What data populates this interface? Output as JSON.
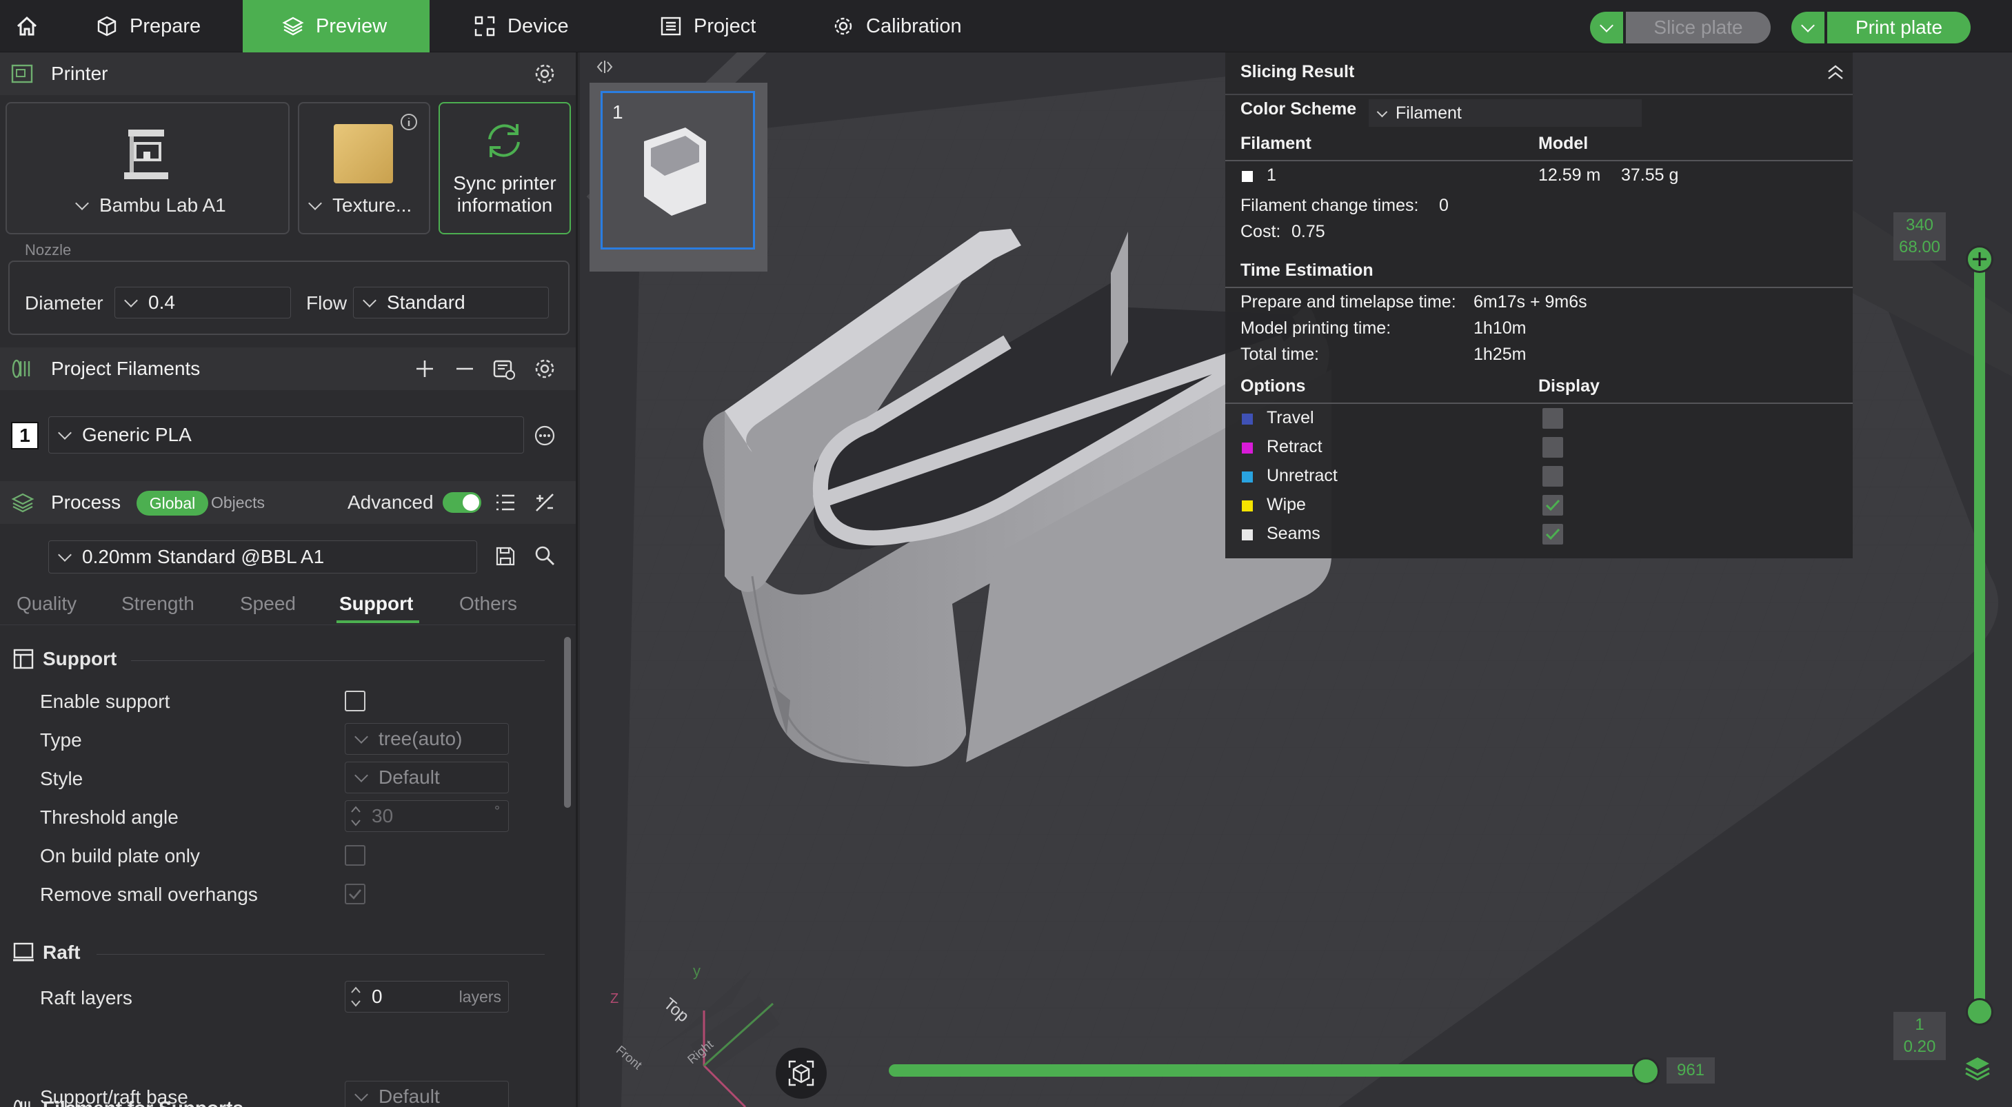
{
  "topbar": {
    "tabs": [
      {
        "label": "Prepare"
      },
      {
        "label": "Preview"
      },
      {
        "label": "Device"
      },
      {
        "label": "Project"
      },
      {
        "label": "Calibration"
      }
    ],
    "slice_plate": "Slice plate",
    "print_plate": "Print plate",
    "accent": "#4caf50"
  },
  "printer": {
    "title": "Printer",
    "model": "Bambu Lab A1",
    "plate": "Texture...",
    "sync_line1": "Sync printer",
    "sync_line2": "information",
    "nozzle_label": "Nozzle",
    "diameter_label": "Diameter",
    "diameter_value": "0.4",
    "flow_label": "Flow",
    "flow_value": "Standard"
  },
  "filaments": {
    "title": "Project Filaments",
    "items": [
      {
        "index": "1",
        "name": "Generic PLA"
      }
    ]
  },
  "process": {
    "title": "Process",
    "global": "Global",
    "objects": "Objects",
    "advanced": "Advanced",
    "advanced_on": true,
    "profile": "0.20mm Standard @BBL A1",
    "tabs": [
      "Quality",
      "Strength",
      "Speed",
      "Support",
      "Others"
    ],
    "active_tab": "Support"
  },
  "support": {
    "title": "Support",
    "enable_support": "Enable support",
    "type_label": "Type",
    "type_value": "tree(auto)",
    "style_label": "Style",
    "style_value": "Default",
    "threshold_label": "Threshold angle",
    "threshold_value": "30",
    "threshold_unit": "°",
    "build_plate_label": "On build plate only",
    "remove_overhangs_label": "Remove small overhangs",
    "raft_title": "Raft",
    "raft_layers_label": "Raft layers",
    "raft_layers_value": "0",
    "raft_layers_unit": "layers",
    "filament_supports_title": "Filament for Supports",
    "support_raft_base_label": "Support/raft base",
    "support_raft_base_value": "Default"
  },
  "viewport": {
    "plate_number": "1",
    "axis_z": "Z",
    "axis_y": "y",
    "cube_top": "Top",
    "cube_front": "Front",
    "cube_right": "Right",
    "layer_top_count": "340",
    "layer_top_height": "68.00",
    "layer_bottom_count": "1",
    "layer_bottom_height": "0.20",
    "move_value": "961"
  },
  "slicing_result": {
    "title": "Slicing Result",
    "color_scheme_label": "Color Scheme",
    "color_scheme_value": "Filament",
    "filament_header": "Filament",
    "model_header": "Model",
    "filament_id": "1",
    "filament_length": "12.59 m",
    "filament_weight": "37.55 g",
    "change_times_label": "Filament change times:",
    "change_times_value": "0",
    "cost_label": "Cost:",
    "cost_value": "0.75",
    "time_title": "Time Estimation",
    "prepare_label": "Prepare and timelapse time:",
    "prepare_value": "6m17s + 9m6s",
    "model_time_label": "Model printing time:",
    "model_time_value": "1h10m",
    "total_label": "Total time:",
    "total_value": "1h25m",
    "options_header": "Options",
    "display_header": "Display",
    "options": [
      {
        "label": "Travel",
        "color": "#3f51b5",
        "checked": false
      },
      {
        "label": "Retract",
        "color": "#d81bd8",
        "checked": false
      },
      {
        "label": "Unretract",
        "color": "#29a3e0",
        "checked": false
      },
      {
        "label": "Wipe",
        "color": "#f5e400",
        "checked": true
      },
      {
        "label": "Seams",
        "color": "#e8e8e8",
        "checked": true
      }
    ]
  }
}
